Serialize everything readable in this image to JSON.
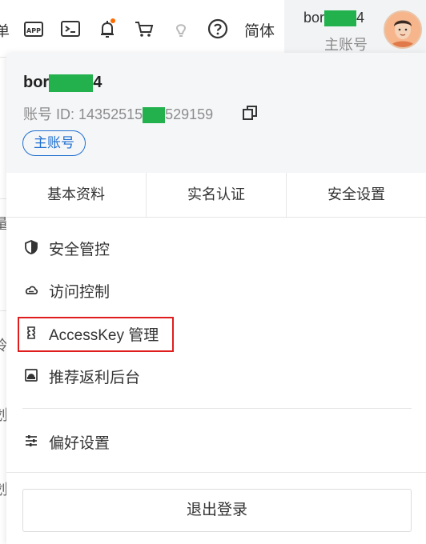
{
  "topbar": {
    "edge_text": "单",
    "icons": [
      "app-icon",
      "terminal-icon",
      "bell-icon",
      "cart-icon",
      "lightbulb-icon",
      "help-icon"
    ],
    "notification_dot_color": "#ff6a00",
    "language": "简体",
    "user": {
      "name_prefix": "bor",
      "name_suffix": "4",
      "role": "主账号"
    }
  },
  "left_fragments": [
    "量",
    "冷",
    "划",
    "划"
  ],
  "panel": {
    "name_prefix": "bor",
    "name_suffix": "4",
    "id_label": "账号 ID:",
    "id_prefix": "14352515",
    "id_suffix": "529159",
    "badge": "主账号",
    "tabs": [
      "基本资料",
      "实名认证",
      "安全设置"
    ],
    "menu": [
      {
        "icon": "shield-icon",
        "label": "安全管控"
      },
      {
        "icon": "cloud-icon",
        "label": "访问控制"
      },
      {
        "icon": "key-icon",
        "label": "AccessKey 管理"
      },
      {
        "icon": "storefront-icon",
        "label": "推荐返利后台"
      },
      {
        "icon": "sliders-icon",
        "label": "偏好设置"
      }
    ],
    "logout": "退出登录"
  },
  "colors": {
    "accent": "#1f6fcf",
    "highlight": "#e01d1d",
    "redaction": "#22b14c"
  }
}
